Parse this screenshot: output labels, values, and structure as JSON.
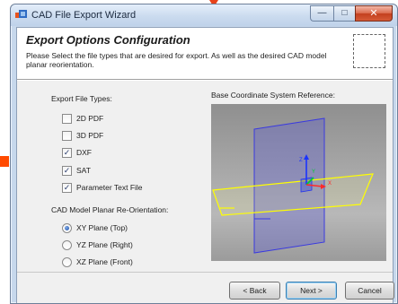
{
  "window": {
    "title": "CAD File Export Wizard",
    "buttons": {
      "minimize": "—",
      "maximize": "□",
      "close": "✕"
    }
  },
  "header": {
    "title": "Export Options Configuration",
    "description": "Please Select the file types that are desired for export. As well as the desired CAD model planar reorientation."
  },
  "export_types": {
    "label": "Export File Types:",
    "items": [
      {
        "label": "2D PDF",
        "checked": false
      },
      {
        "label": "3D PDF",
        "checked": false
      },
      {
        "label": "DXF",
        "checked": true
      },
      {
        "label": "SAT",
        "checked": true
      },
      {
        "label": "Parameter Text File",
        "checked": true
      }
    ]
  },
  "reorientation": {
    "label": "CAD Model Planar Re-Orientation:",
    "items": [
      {
        "label": "XY Plane (Top)",
        "selected": true
      },
      {
        "label": "YZ Plane (Right)",
        "selected": false
      },
      {
        "label": "XZ Plane (Front)",
        "selected": false
      }
    ]
  },
  "coord_ref": {
    "label": "Base Coordinate System Reference:",
    "axis_z": "Z",
    "axis_y": "Y",
    "axis_x": "X"
  },
  "footer": {
    "back": "< Back",
    "next": "Next >",
    "cancel": "Cancel"
  },
  "colors": {
    "plane_xy": "#ffff00",
    "plane_yz": "#3a3adf",
    "axis_z": "#1a33ff",
    "axis_y": "#00cc33",
    "axis_x": "#ff2a2a"
  }
}
